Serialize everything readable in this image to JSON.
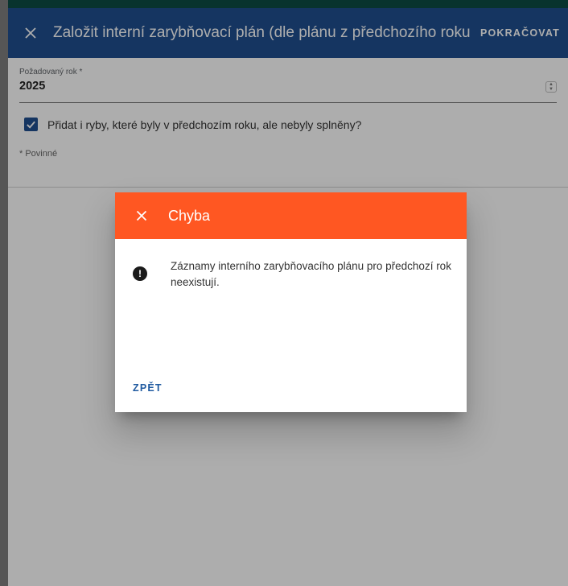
{
  "colors": {
    "toolbar": "#1f4f8f",
    "error_header": "#ff5722",
    "accent_button": "#1f5aa0"
  },
  "dialog": {
    "title": "Založit interní zarybňovací plán (dle plánu z předchozího roku",
    "continue_label": "POKRAČOVAT",
    "close_icon": "close-icon"
  },
  "form": {
    "year_label": "Požadovaný rok *",
    "year_value": "2025",
    "add_fish_checked": true,
    "add_fish_label": "Přidat i ryby, které byly v předchozím roku, ale nebyly splněny?",
    "required_note": "* Povinné"
  },
  "error": {
    "title": "Chyba",
    "message": "Záznamy interního zarybňovacího plánu pro předchozí rok neexistují.",
    "back_label": "ZPĚT",
    "icon": "exclamation-icon"
  }
}
